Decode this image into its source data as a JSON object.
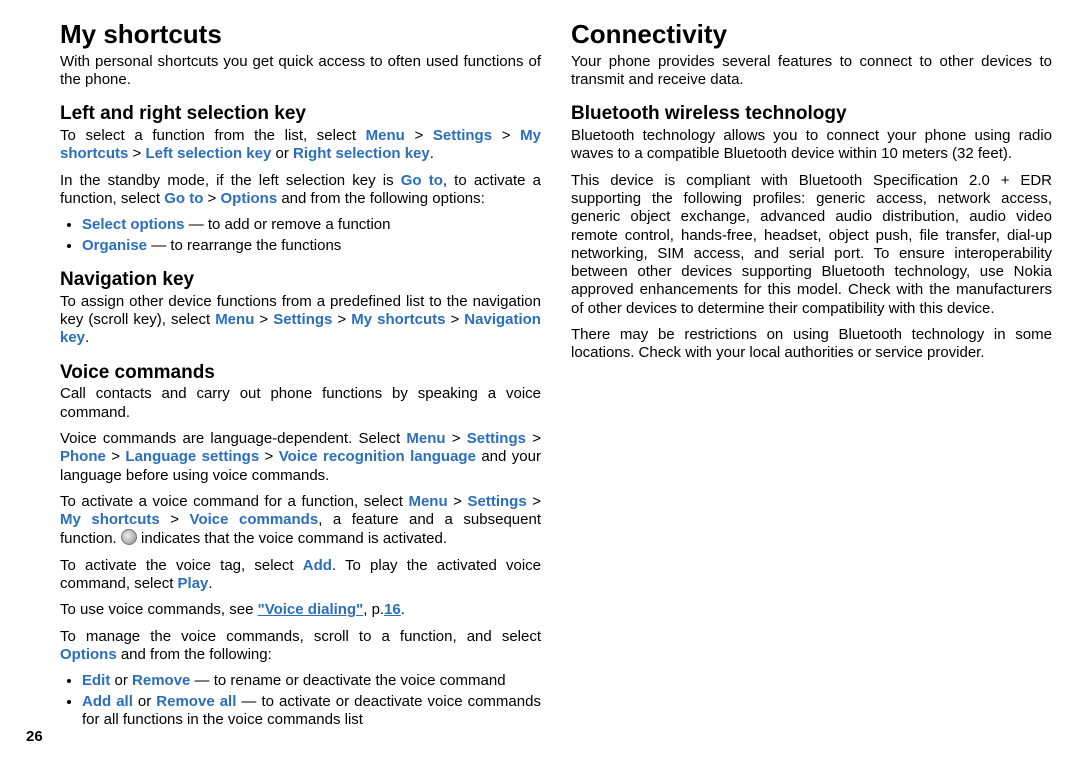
{
  "pageNumber": "26",
  "col1": {
    "h1_shortcuts": "My shortcuts",
    "p_intro": "With personal shortcuts you get quick access to often used functions of the phone.",
    "h2_lrkey": "Left and right selection key",
    "lr_p1a": "To select a function from the list, select ",
    "lr_menu": "Menu",
    "lr_gt1": " > ",
    "lr_settings": "Settings",
    "lr_gt2": " > ",
    "lr_myshort": "My shortcuts",
    "lr_gt3": " > ",
    "lr_left": "Left selection key",
    "lr_or": " or ",
    "lr_right": "Right selection key",
    "lr_dot": ".",
    "lr_p2a": "In the standby mode, if the left selection key is ",
    "lr_goto1": "Go to",
    "lr_p2b": ", to activate a function, select ",
    "lr_goto2": "Go to",
    "lr_gtb": " > ",
    "lr_options": "Options",
    "lr_p2c": " and from the following options:",
    "lr_li1a": "Select options",
    "lr_li1b": " — to add or remove a function",
    "lr_li2a": "Organise",
    "lr_li2b": " — to rearrange the functions",
    "h2_nav": "Navigation key",
    "nav_p1a": "To assign other device functions from a predefined list to the navigation key (scroll key), select ",
    "nav_menu": "Menu",
    "nav_gt1": " > ",
    "nav_settings": "Settings",
    "nav_gt2": " > ",
    "nav_myshort": "My shortcuts",
    "nav_gt3": " > ",
    "nav_key": "Navigation key",
    "nav_dot": ".",
    "h2_voice": "Voice commands",
    "vc_p1": "Call contacts and carry out phone functions by speaking a voice command.",
    "vc_p2a": "Voice commands are language-dependent. Select ",
    "vc_menu": "Menu",
    "vc_gt1": " > ",
    "vc_settings": "Settings",
    "vc_gt2": " > ",
    "vc_phone": "Phone",
    "vc_gt3": " > ",
    "vc_lang": "Language settings",
    "vc_gt4": " > ",
    "vc_vrl": "Voice recognition language",
    "vc_p2b": " and your language before using voice commands.",
    "vc_p3a": "To activate a voice command for a function, select ",
    "vc_menu2": "Menu",
    "vc_gt5": " > ",
    "vc_settings2": "Settings",
    "vc_gt6": " > ",
    "vc_myshort2": "My shortcuts",
    "vc_gt7": " > ",
    "vc_vcmd": "Voice commands",
    "vc_p3b": ", a feature and a subsequent function. ",
    "vc_p3c": " indicates that the voice command is activated."
  },
  "col2": {
    "top_p1a": "To activate the voice tag, select ",
    "top_add": "Add",
    "top_p1b": ". To play the activated voice command, select ",
    "top_play": "Play",
    "top_dot": ".",
    "top_p2a": "To use voice commands, see ",
    "top_link": "\"Voice dialing\"",
    "top_p2b": ", p.",
    "top_pnum": "16",
    "top_p2c": ".",
    "top_p3a": "To manage the voice commands, scroll to a function, and select ",
    "top_options": "Options",
    "top_p3b": " and from the following:",
    "li1a": "Edit",
    "li1or": " or ",
    "li1b": "Remove",
    "li1c": " — to rename or deactivate the voice command",
    "li2a": "Add all",
    "li2or": " or ",
    "li2b": "Remove all",
    "li2c": " — to activate or deactivate voice commands for all functions in the voice commands list",
    "h1_conn": "Connectivity",
    "conn_p": "Your phone provides several features to connect to other devices to transmit and receive data.",
    "h2_bt": "Bluetooth wireless technology",
    "bt_p1": "Bluetooth technology allows you to connect your phone using radio waves to a compatible Bluetooth device within 10 meters (32 feet).",
    "bt_p2": "This device is compliant with Bluetooth Specification 2.0 + EDR supporting the following profiles: generic access, network access, generic object exchange, advanced audio distribution, audio video remote control, hands-free, headset, object push, file transfer, dial-up networking, SIM access, and serial port. To ensure interoperability between other devices supporting Bluetooth technology, use Nokia approved enhancements for this model. Check with the manufacturers of other devices to determine their compatibility with this device.",
    "bt_p3": "There may be restrictions on using Bluetooth technology in some locations. Check with your local authorities or service provider."
  }
}
